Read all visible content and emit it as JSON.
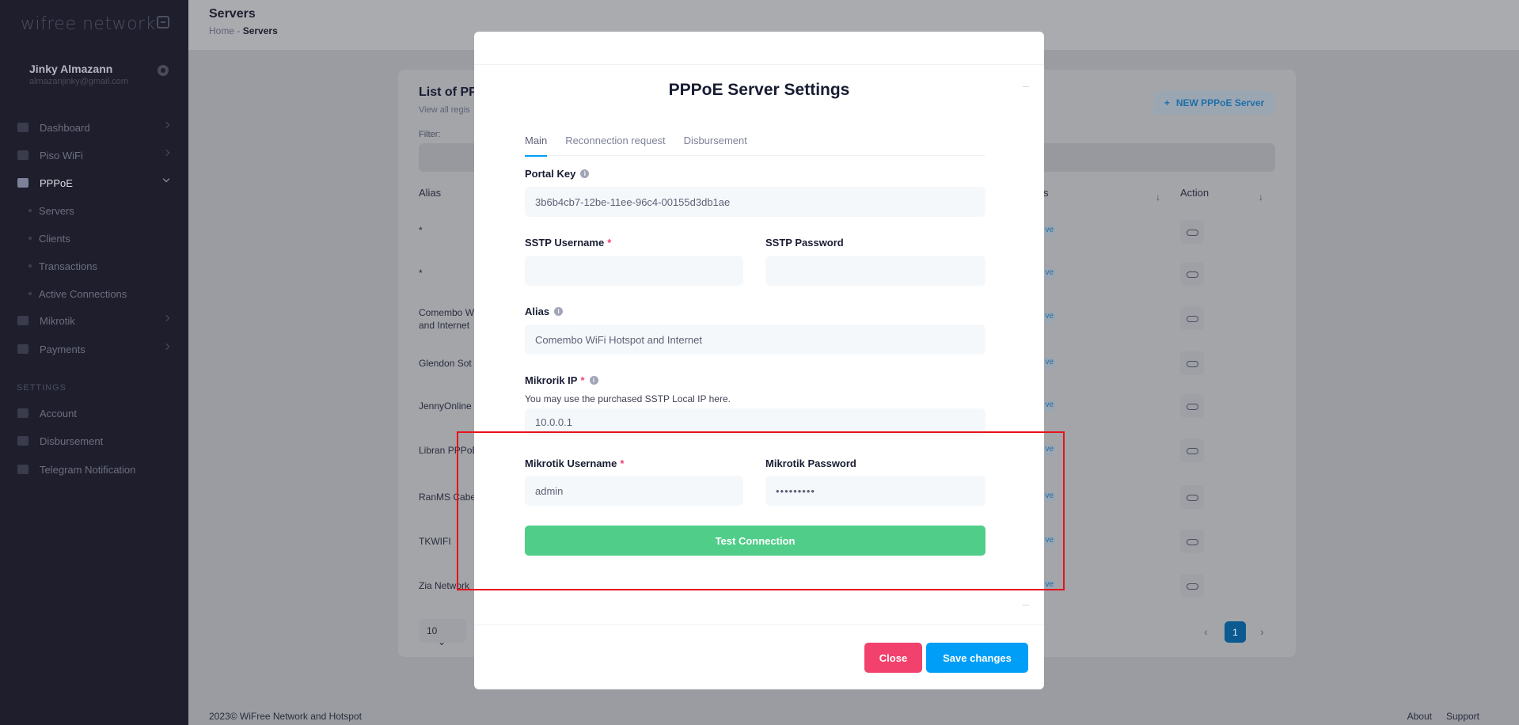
{
  "sidebar": {
    "logo": "wifree network",
    "user": {
      "name": "Jinky Almazann",
      "email": "almazanjinky@gmail.com"
    },
    "menu": [
      {
        "label": "Dashboard",
        "icon": "dashboard-icon"
      },
      {
        "label": "Piso WiFi",
        "icon": "wifi-icon"
      },
      {
        "label": "PPPoE",
        "icon": "server-icon"
      },
      {
        "label": "Mikrotik",
        "icon": "router-icon"
      },
      {
        "label": "Payments",
        "icon": "payment-icon"
      }
    ],
    "pppoe_sub": [
      "Servers",
      "Clients",
      "Transactions",
      "Active Connections"
    ],
    "settings_title": "SETTINGS",
    "settings": [
      {
        "label": "Account",
        "icon": "user-icon"
      },
      {
        "label": "Disbursement",
        "icon": "wallet-icon"
      },
      {
        "label": "Telegram Notification",
        "icon": "bell-icon"
      }
    ]
  },
  "header": {
    "title": "Servers",
    "breadcrumb": {
      "home": "Home",
      "sep": "-",
      "current": "Servers"
    }
  },
  "card": {
    "title": "List of PPP",
    "subtitle": "View all regis",
    "filter_label": "Filter:",
    "new_button": "NEW PPPoE Server",
    "columns": {
      "alias": "Alias",
      "status": "s",
      "action": "Action"
    },
    "rows": [
      {
        "alias": "*",
        "status": "ve"
      },
      {
        "alias": "*",
        "status": "ve"
      },
      {
        "alias": "Comembo W",
        "alias2": "and Internet",
        "status": "ve"
      },
      {
        "alias": "Glendon Sot",
        "status": "ve"
      },
      {
        "alias": "JennyOnline",
        "status": "ve"
      },
      {
        "alias": "Libran PPPoE",
        "status": "ve"
      },
      {
        "alias": "RanMS Cabe",
        "status": "ve"
      },
      {
        "alias": "TKWIFI",
        "status": "ve"
      },
      {
        "alias": "Zia Network",
        "status": "ve"
      }
    ],
    "page_size": "10",
    "current_page": "1"
  },
  "footer": {
    "copyright": "2023©  WiFree Network and Hotspot",
    "about": "About",
    "support": "Support"
  },
  "modal": {
    "title": "PPPoE Server Settings",
    "tabs": [
      "Main",
      "Reconnection request",
      "Disbursement"
    ],
    "portal_key": {
      "label": "Portal Key",
      "value": "3b6b4cb7-12be-11ee-96c4-00155d3db1ae"
    },
    "sstp_username": {
      "label": "SSTP Username",
      "value": ""
    },
    "sstp_password": {
      "label": "SSTP Password",
      "value": ""
    },
    "alias": {
      "label": "Alias",
      "value": "Comembo WiFi Hotspot and Internet"
    },
    "mikrotik_ip": {
      "label": "Mikrorik IP",
      "hint": "You may use the purchased SSTP Local IP here.",
      "value": "10.0.0.1"
    },
    "mikrotik_username": {
      "label": "Mikrotik Username",
      "value": "admin"
    },
    "mikrotik_password": {
      "label": "Mikrotik Password",
      "value": "•••••••••"
    },
    "test_button": "Test Connection",
    "close_button": "Close",
    "save_button": "Save changes",
    "required_mark": "*",
    "info_mark": "i"
  },
  "colors": {
    "primary": "#009ef7",
    "success": "#50cd89",
    "danger": "#f1416c",
    "highlight": "#e8121c",
    "sidebar": "#1e1e2d"
  }
}
